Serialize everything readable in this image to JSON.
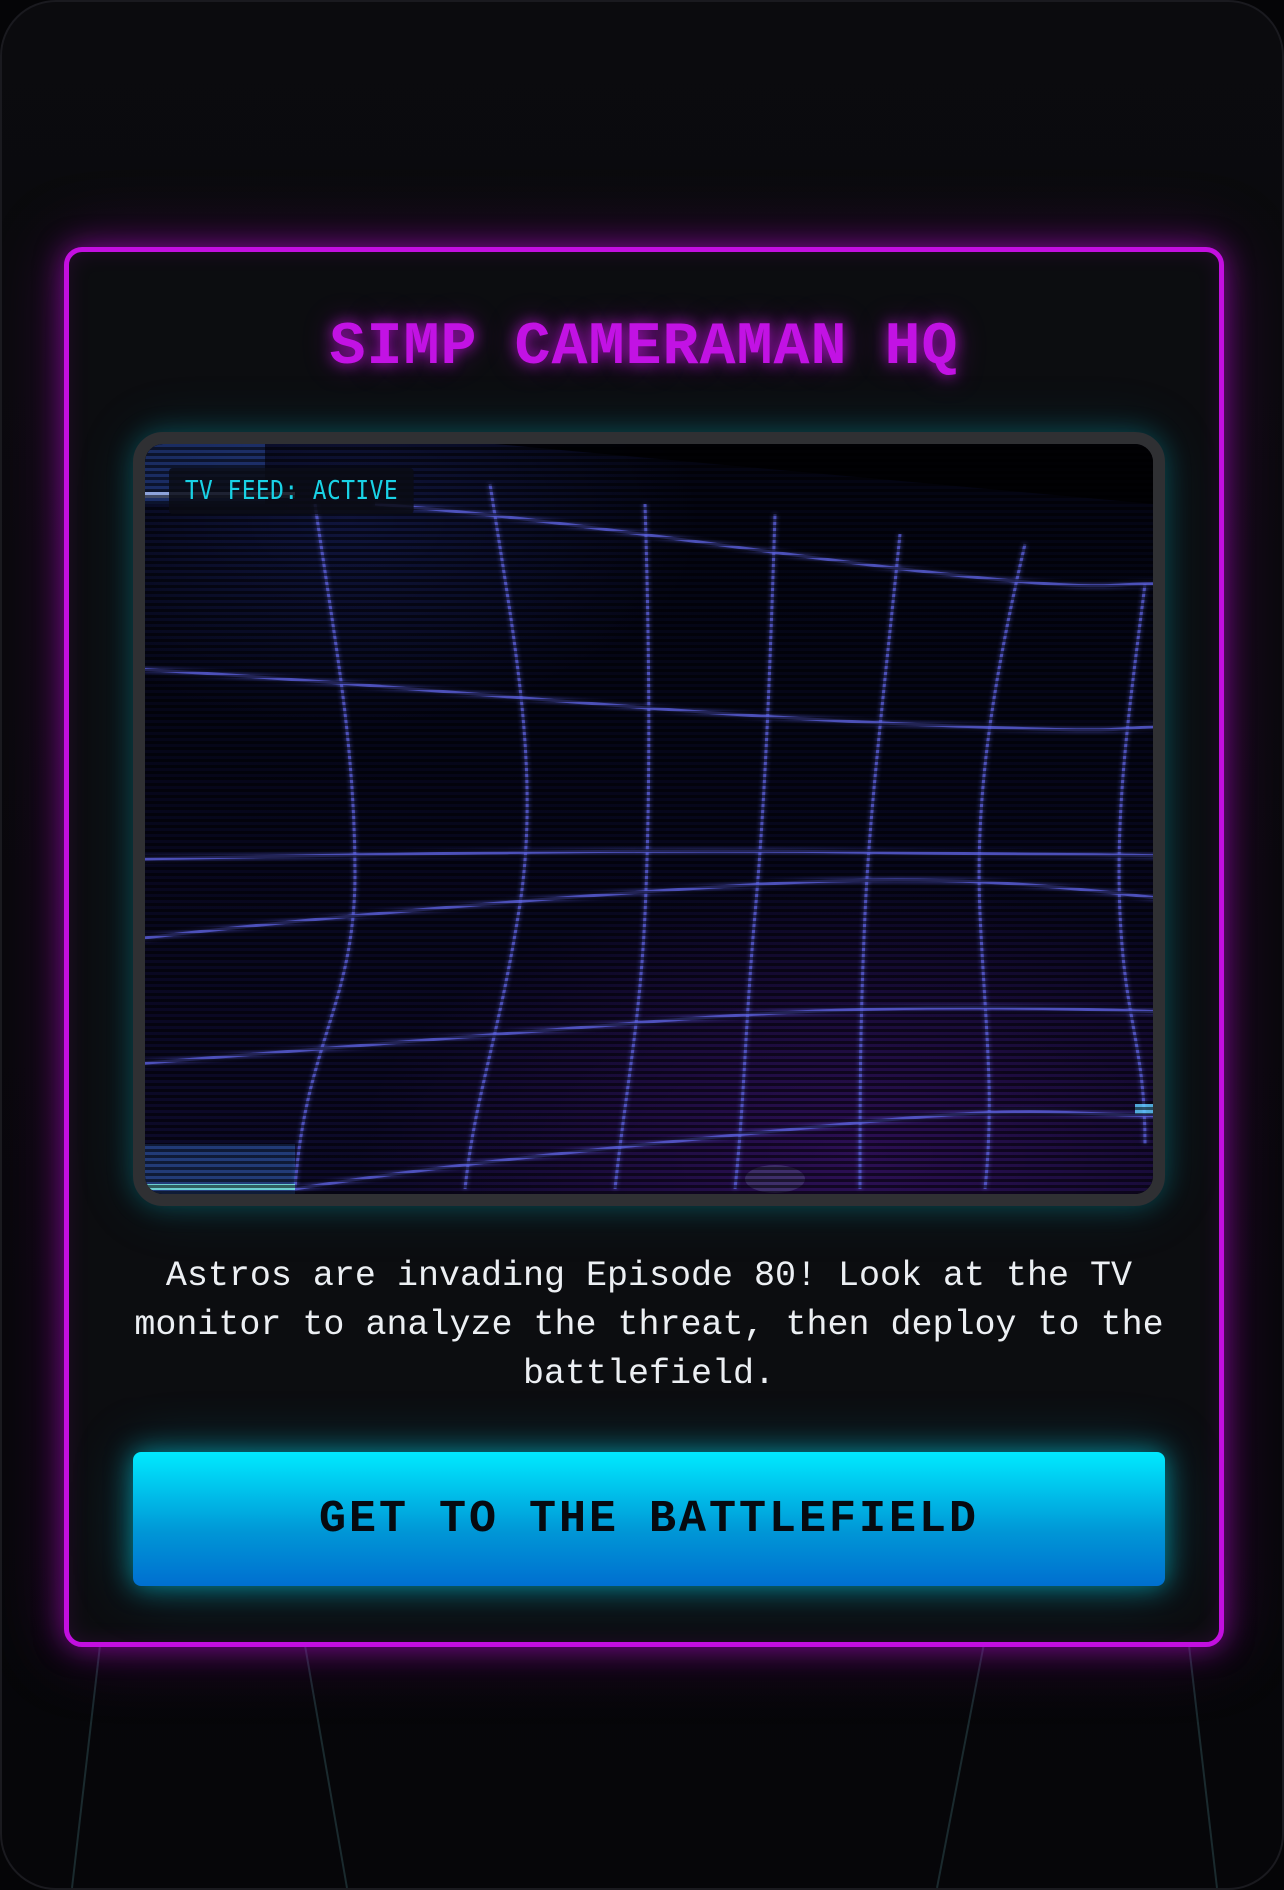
{
  "panel": {
    "title": "SIMP CAMERAMAN HQ"
  },
  "monitor": {
    "badge": "TV FEED: ACTIVE"
  },
  "description": "Astros are invading Episode 80! Look at the TV monitor to analyze the threat, then deploy to the battlefield.",
  "cta": {
    "label": "GET TO THE BATTLEFIELD"
  },
  "colors": {
    "panel_border": "#c30fe0",
    "title": "#c212e4",
    "badge_text": "#19d2e6",
    "button_top": "#00eaff",
    "button_bottom": "#006fd0"
  }
}
